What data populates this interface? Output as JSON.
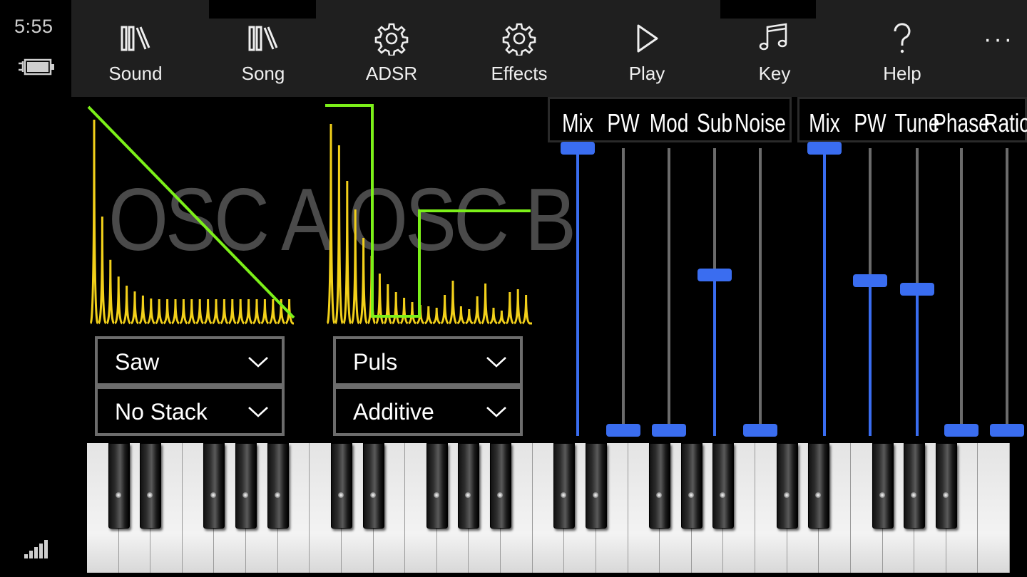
{
  "status": {
    "time": "5:55"
  },
  "toolbar": {
    "items": [
      {
        "label": "Sound",
        "icon": "library-icon"
      },
      {
        "label": "Song",
        "icon": "library-icon"
      },
      {
        "label": "ADSR",
        "icon": "gear-icon"
      },
      {
        "label": "Effects",
        "icon": "gear-icon"
      },
      {
        "label": "Play",
        "icon": "play-icon"
      },
      {
        "label": "Key",
        "icon": "music-note-icon"
      },
      {
        "label": "Help",
        "icon": "question-icon"
      }
    ],
    "more": "···"
  },
  "osc_a": {
    "title": "OSC A",
    "waveform": "Saw",
    "stack": "No Stack",
    "wave_color": "#7cf019",
    "spectrum_color": "#f2d01a"
  },
  "osc_b": {
    "title": "OSC B",
    "waveform": "Puls",
    "mode": "Additive",
    "wave_color": "#7cf019",
    "spectrum_color": "#f2d01a"
  },
  "sliders_a": {
    "labels": [
      "Mix",
      "PW",
      "Mod",
      "Sub",
      "Noise"
    ],
    "values": [
      1.0,
      0.0,
      0.0,
      0.55,
      0.0
    ]
  },
  "sliders_b": {
    "labels": [
      "Mix",
      "PW",
      "Tune",
      "Phase",
      "Ratio"
    ],
    "values": [
      1.0,
      0.53,
      0.5,
      0.0,
      0.0
    ]
  },
  "colors": {
    "accent": "#3a6df0",
    "appbar": "#1f1f1f"
  }
}
